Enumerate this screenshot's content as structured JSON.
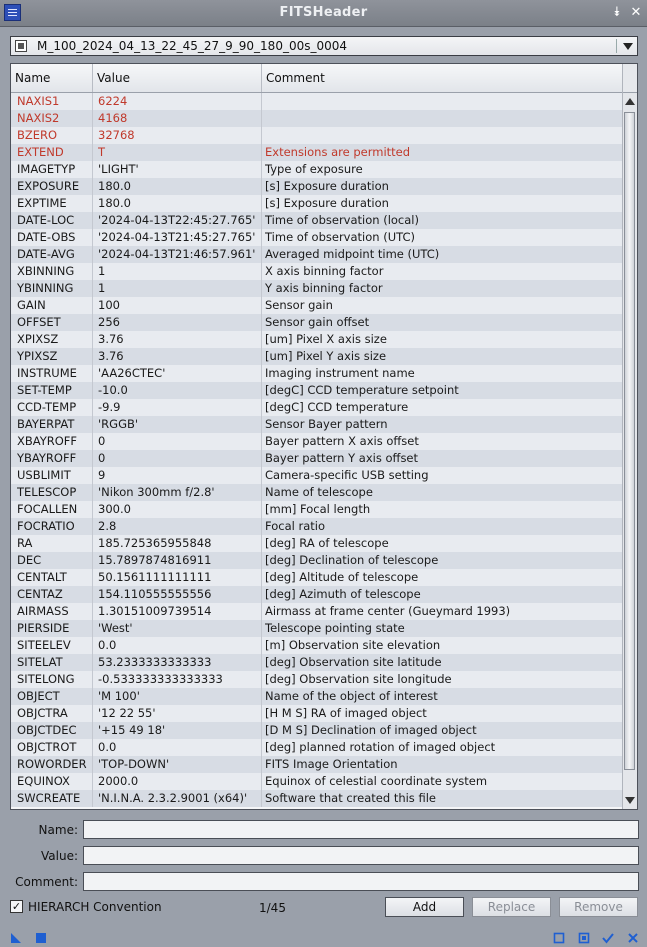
{
  "window": {
    "title": "FITSHeader",
    "pin_glyph": "⯯",
    "close_glyph": "✕"
  },
  "file_selector": {
    "value": "M_100_2024_04_13_22_45_27_9_90_180_00s_0004"
  },
  "table": {
    "headers": {
      "name": "Name",
      "value": "Value",
      "comment": "Comment"
    },
    "rows": [
      {
        "name": "NAXIS1",
        "value": "6224",
        "comment": "",
        "fixed": true
      },
      {
        "name": "NAXIS2",
        "value": "4168",
        "comment": "",
        "fixed": true
      },
      {
        "name": "BZERO",
        "value": "32768",
        "comment": "",
        "fixed": true
      },
      {
        "name": "EXTEND",
        "value": "T",
        "comment": "Extensions are permitted",
        "fixed": true
      },
      {
        "name": "IMAGETYP",
        "value": "'LIGHT'",
        "comment": "Type of exposure"
      },
      {
        "name": "EXPOSURE",
        "value": "180.0",
        "comment": "[s] Exposure duration"
      },
      {
        "name": "EXPTIME",
        "value": "180.0",
        "comment": "[s] Exposure duration"
      },
      {
        "name": "DATE-LOC",
        "value": "'2024-04-13T22:45:27.765'",
        "comment": "Time of observation (local)"
      },
      {
        "name": "DATE-OBS",
        "value": "'2024-04-13T21:45:27.765'",
        "comment": "Time of observation (UTC)"
      },
      {
        "name": "DATE-AVG",
        "value": "'2024-04-13T21:46:57.961'",
        "comment": "Averaged midpoint time (UTC)"
      },
      {
        "name": "XBINNING",
        "value": "1",
        "comment": "X axis binning factor"
      },
      {
        "name": "YBINNING",
        "value": "1",
        "comment": "Y axis binning factor"
      },
      {
        "name": "GAIN",
        "value": "100",
        "comment": "Sensor gain"
      },
      {
        "name": "OFFSET",
        "value": "256",
        "comment": "Sensor gain offset"
      },
      {
        "name": "XPIXSZ",
        "value": "3.76",
        "comment": "[um] Pixel X axis size"
      },
      {
        "name": "YPIXSZ",
        "value": "3.76",
        "comment": "[um] Pixel Y axis size"
      },
      {
        "name": "INSTRUME",
        "value": "'AA26CTEC'",
        "comment": "Imaging instrument name"
      },
      {
        "name": "SET-TEMP",
        "value": "-10.0",
        "comment": "[degC] CCD temperature setpoint"
      },
      {
        "name": "CCD-TEMP",
        "value": "-9.9",
        "comment": "[degC] CCD temperature"
      },
      {
        "name": "BAYERPAT",
        "value": "'RGGB'",
        "comment": "Sensor Bayer pattern"
      },
      {
        "name": "XBAYROFF",
        "value": "0",
        "comment": "Bayer pattern X axis offset"
      },
      {
        "name": "YBAYROFF",
        "value": "0",
        "comment": "Bayer pattern Y axis offset"
      },
      {
        "name": "USBLIMIT",
        "value": "9",
        "comment": "Camera-specific USB setting"
      },
      {
        "name": "TELESCOP",
        "value": "'Nikon 300mm f/2.8'",
        "comment": "Name of telescope"
      },
      {
        "name": "FOCALLEN",
        "value": "300.0",
        "comment": "[mm] Focal length"
      },
      {
        "name": "FOCRATIO",
        "value": "2.8",
        "comment": "Focal ratio"
      },
      {
        "name": "RA",
        "value": "185.725365955848",
        "comment": "[deg] RA of telescope"
      },
      {
        "name": "DEC",
        "value": "15.7897874816911",
        "comment": "[deg] Declination of telescope"
      },
      {
        "name": "CENTALT",
        "value": "50.1561111111111",
        "comment": "[deg] Altitude of telescope"
      },
      {
        "name": "CENTAZ",
        "value": "154.110555555556",
        "comment": "[deg] Azimuth of telescope"
      },
      {
        "name": "AIRMASS",
        "value": "1.30151009739514",
        "comment": "Airmass at frame center (Gueymard 1993)"
      },
      {
        "name": "PIERSIDE",
        "value": "'West'",
        "comment": "Telescope pointing state"
      },
      {
        "name": "SITEELEV",
        "value": "0.0",
        "comment": "[m] Observation site elevation"
      },
      {
        "name": "SITELAT",
        "value": "53.2333333333333",
        "comment": "[deg] Observation site latitude"
      },
      {
        "name": "SITELONG",
        "value": "-0.533333333333333",
        "comment": "[deg] Observation site longitude"
      },
      {
        "name": "OBJECT",
        "value": "'M 100'",
        "comment": "Name of the object of interest"
      },
      {
        "name": "OBJCTRA",
        "value": "'12 22 55'",
        "comment": "[H M S] RA of imaged object"
      },
      {
        "name": "OBJCTDEC",
        "value": "'+15 49 18'",
        "comment": "[D M S] Declination of imaged object"
      },
      {
        "name": "OBJCTROT",
        "value": "0.0",
        "comment": "[deg] planned rotation of imaged object"
      },
      {
        "name": "ROWORDER",
        "value": "'TOP-DOWN'",
        "comment": "FITS Image Orientation"
      },
      {
        "name": "EQUINOX",
        "value": "2000.0",
        "comment": "Equinox of celestial coordinate system"
      },
      {
        "name": "SWCREATE",
        "value": "'N.I.N.A. 2.3.2.9001 (x64)'",
        "comment": "Software that created this file"
      }
    ]
  },
  "form": {
    "name_label": "Name:",
    "value_label": "Value:",
    "comment_label": "Comment:",
    "name_value": "",
    "value_value": "",
    "comment_value": ""
  },
  "footer": {
    "hierarch_label": "HIERARCH Convention",
    "hierarch_checked": true,
    "counter": "1/45",
    "add_label": "Add",
    "replace_label": "Replace",
    "remove_label": "Remove"
  },
  "colors": {
    "fixed_keyword": "#c0392b",
    "status_icon": "#1f5fd1"
  }
}
